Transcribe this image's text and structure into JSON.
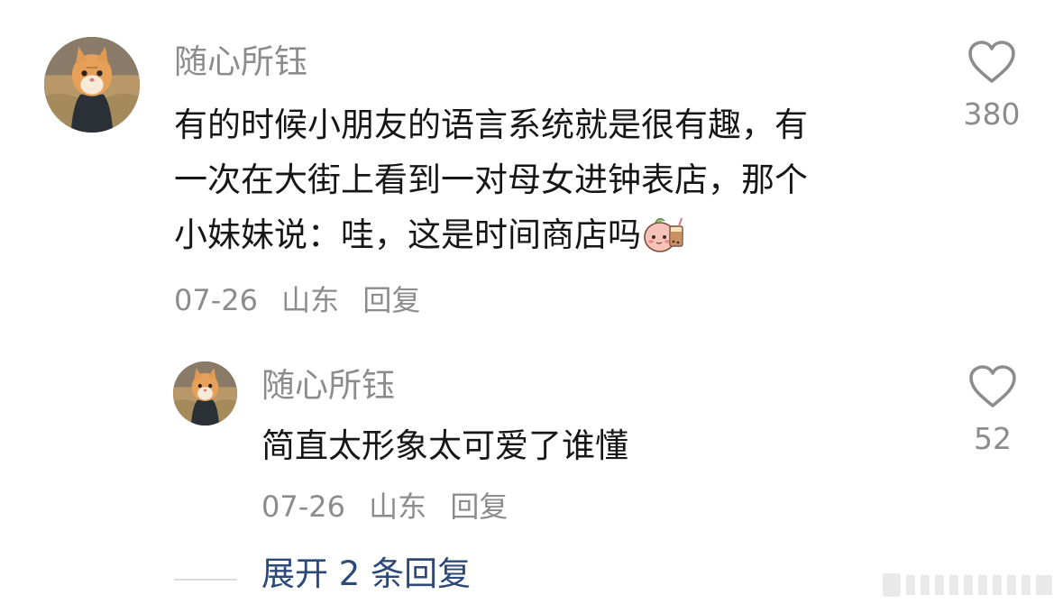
{
  "comment": {
    "username": "随心所钰",
    "text_lines": [
      "有的时候小朋友的语言系统就是很有趣，有",
      "一次在大街上看到一对母女进钟表店，那个",
      "小妹妹说：哇，这是时间商店吗"
    ],
    "sticker": "peach-shy-milktea-sticker",
    "date": "07-26",
    "location": "山东",
    "reply_label": "回复",
    "likes": "380"
  },
  "reply": {
    "username": "随心所钰",
    "text": "简直太形象太可爱了谁懂",
    "date": "07-26",
    "location": "山东",
    "reply_label": "回复",
    "likes": "52"
  },
  "expand": {
    "label": "展开 2 条回复"
  },
  "colors": {
    "text": "#161616",
    "muted": "#8c8c8c",
    "link": "#2b4a78"
  }
}
